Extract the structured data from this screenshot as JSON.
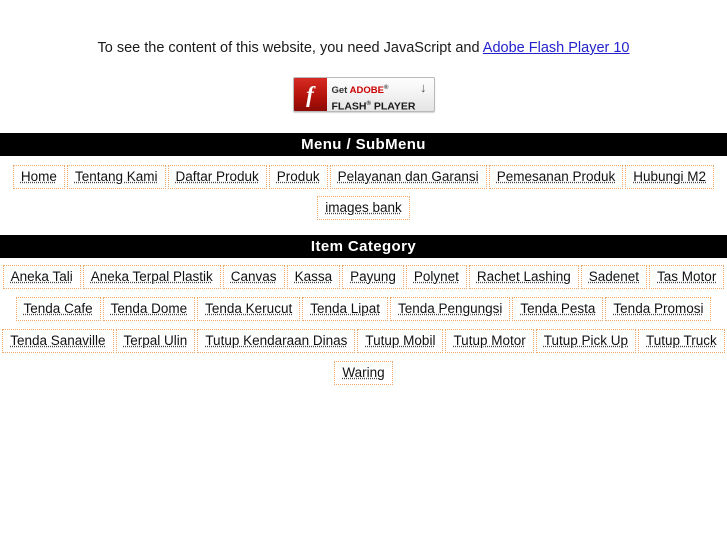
{
  "notice": {
    "text_before": "To see the content of this website, you need JavaScript and ",
    "link_label": "Adobe Flash Player 10",
    "link_color": "#2222cc"
  },
  "flash_badge": {
    "icon": "flash-f-icon",
    "line1_get": "Get ",
    "line1_adobe": "ADOBE",
    "line1_sup": "®",
    "line2_flash": "FLASH",
    "line2_sup": "®",
    "line2_player": " PLAYER",
    "download_arrow": "↓",
    "brand_red": "#cc0000"
  },
  "menu_section": {
    "title": "Menu / SubMenu",
    "rows": [
      [
        {
          "label": "Home"
        },
        {
          "label": "Tentang Kami"
        },
        {
          "label": "Daftar Produk"
        },
        {
          "label": "Produk"
        },
        {
          "label": "Pelayanan dan Garansi"
        },
        {
          "label": "Pemesanan Produk"
        },
        {
          "label": "Hubungi M2"
        }
      ],
      [
        {
          "label": "images bank"
        }
      ]
    ]
  },
  "category_section": {
    "title": "Item Category",
    "rows": [
      [
        {
          "label": "Aneka Tali"
        },
        {
          "label": "Aneka Terpal Plastik"
        },
        {
          "label": "Canvas"
        },
        {
          "label": "Kassa"
        },
        {
          "label": "Payung"
        },
        {
          "label": "Polynet"
        },
        {
          "label": "Rachet Lashing"
        },
        {
          "label": "Sadenet"
        },
        {
          "label": "Tas Motor"
        }
      ],
      [
        {
          "label": "Tenda Cafe"
        },
        {
          "label": "Tenda Dome"
        },
        {
          "label": "Tenda Kerucut"
        },
        {
          "label": "Tenda Lipat"
        },
        {
          "label": "Tenda Pengungsi"
        },
        {
          "label": "Tenda Pesta"
        },
        {
          "label": "Tenda Promosi"
        }
      ],
      [
        {
          "label": "Tenda Sanaville"
        },
        {
          "label": "Terpal Ulin"
        },
        {
          "label": "Tutup Kendaraan Dinas"
        },
        {
          "label": "Tutup Mobil"
        },
        {
          "label": "Tutup Motor"
        },
        {
          "label": "Tutup Pick Up"
        },
        {
          "label": "Tutup Truck"
        }
      ],
      [
        {
          "label": "Waring"
        }
      ]
    ]
  },
  "theme": {
    "bar_background": "#000000",
    "bar_text": "#ffffff",
    "link_border": "#f0a868",
    "page_background": "#ffffff"
  }
}
